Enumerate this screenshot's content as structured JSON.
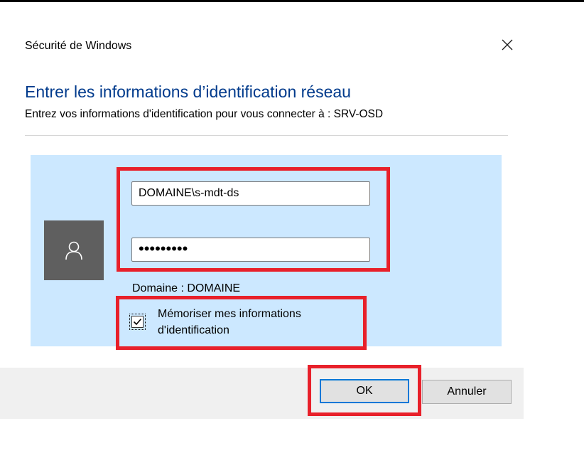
{
  "dialog": {
    "title": "Sécurité de Windows",
    "heading": "Entrer les informations d’identification réseau",
    "subtext": "Entrez vos informations d'identification pour vous connecter à : SRV-OSD"
  },
  "credentials": {
    "username_value": "DOMAINE\\s-mdt-ds",
    "password_mask": "•••••••••",
    "domain_label": "Domaine : DOMAINE",
    "remember_label": "Mémoriser mes informations d'identification",
    "remember_checked": true
  },
  "buttons": {
    "ok_label": "OK",
    "cancel_label": "Annuler"
  },
  "icons": {
    "close": "close-icon",
    "user": "user-icon",
    "check": "checkmark-icon"
  },
  "colors": {
    "heading": "#003a8c",
    "panel": "#cce8ff",
    "avatar_bg": "#5f5f5f",
    "highlight": "#e8202a",
    "focus_border": "#0078d7"
  }
}
